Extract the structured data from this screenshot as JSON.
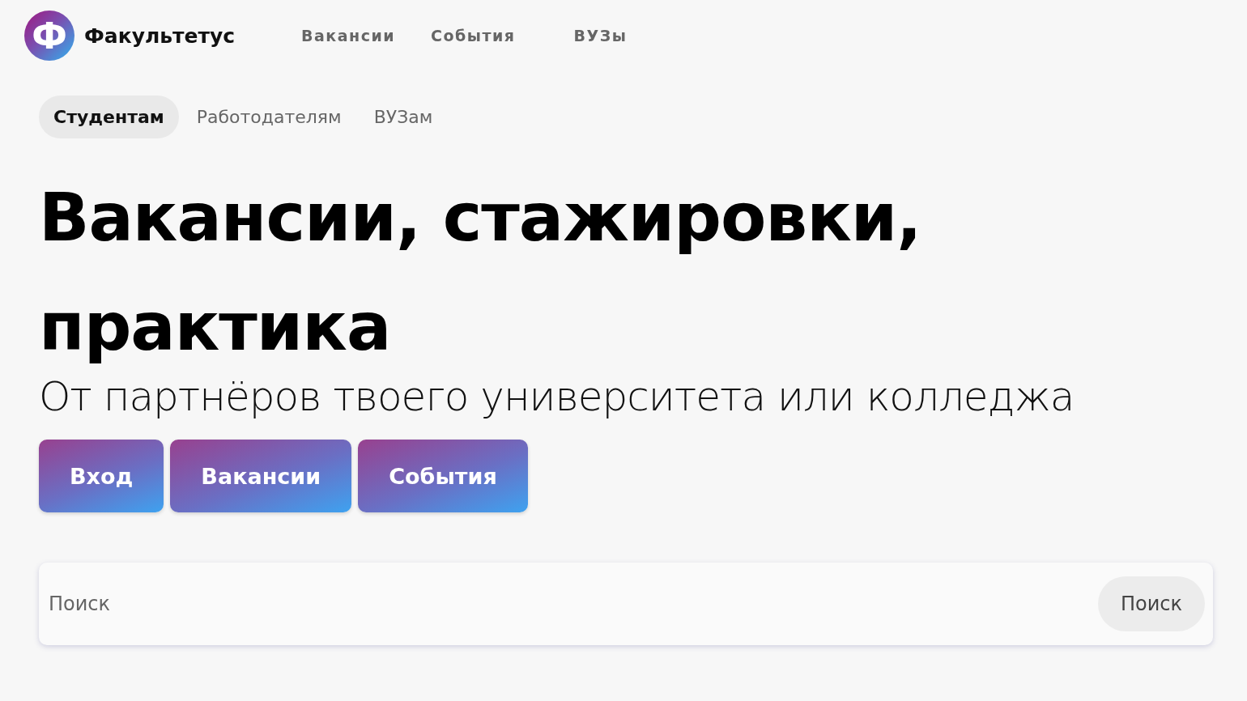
{
  "header": {
    "logo_letter": "Ф",
    "brand": "Факультетус",
    "nav": [
      {
        "label": "Вакансии"
      },
      {
        "label": "События"
      },
      {
        "label": "ВУЗы"
      }
    ]
  },
  "audience_tabs": [
    {
      "label": "Студентам",
      "selected": true
    },
    {
      "label": "Работодателям",
      "selected": false
    },
    {
      "label": "ВУЗам",
      "selected": false
    }
  ],
  "hero": {
    "title": "Вакансии, стажировки, практика",
    "subtitle": "От партнёров твоего университета или колледжа"
  },
  "actions": [
    {
      "label": "Вход"
    },
    {
      "label": "Вакансии"
    },
    {
      "label": "События"
    }
  ],
  "search": {
    "placeholder": "Поиск",
    "button": "Поиск"
  }
}
